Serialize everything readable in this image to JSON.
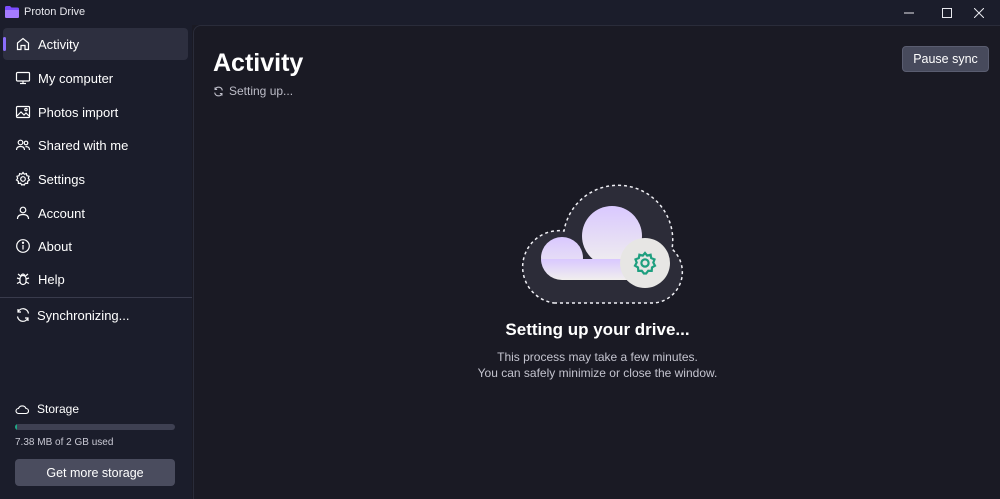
{
  "window": {
    "title": "Proton Drive",
    "controls": {
      "minimize": "minimize-icon",
      "maximize": "maximize-icon",
      "close": "close-icon"
    }
  },
  "sidebar": {
    "items": [
      {
        "label": "Activity",
        "icon": "home-icon",
        "active": true
      },
      {
        "label": "My computer",
        "icon": "monitor-icon"
      },
      {
        "label": "Photos import",
        "icon": "image-icon"
      },
      {
        "label": "Shared with me",
        "icon": "users-icon"
      },
      {
        "label": "Settings",
        "icon": "gear-icon"
      },
      {
        "label": "Account",
        "icon": "user-icon"
      },
      {
        "label": "About",
        "icon": "info-icon"
      },
      {
        "label": "Help",
        "icon": "bug-icon"
      }
    ],
    "sync_status": "Synchronizing...",
    "storage": {
      "label": "Storage",
      "usage_text": "7.38 MB of 2 GB used",
      "used_fraction": 0.0036,
      "button_label": "Get more storage"
    }
  },
  "main": {
    "title": "Activity",
    "status_text": "Setting up...",
    "pause_button": "Pause sync",
    "heading": "Setting up your drive...",
    "line1": "This process may take a few minutes.",
    "line2": "You can safely minimize or close the window."
  },
  "colors": {
    "accent": "#8b6dfb",
    "storage_fill": "#1ea885",
    "sidebar_bg": "#1b1d2b",
    "main_bg": "#1a1a24"
  }
}
